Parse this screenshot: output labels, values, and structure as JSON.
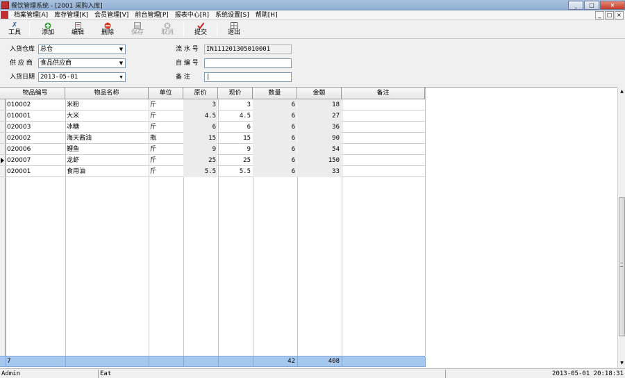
{
  "window": {
    "title": "餐饮管理系统 - [2001 采购入库]",
    "btn_min": "_",
    "btn_max": "□",
    "btn_close": "×"
  },
  "menu": {
    "items": [
      "档案管理[A]",
      "库存管理[K]",
      "会员管理[V]",
      "前台管理[P]",
      "报表中心[R]",
      "系统设置[S]",
      "帮助[H]"
    ],
    "mdi_min": "_",
    "mdi_restore": "□",
    "mdi_close": "×"
  },
  "toolbar": {
    "tools": "工具",
    "add": "添加",
    "edit": "编辑",
    "delete": "删除",
    "save": "保存",
    "cancel": "取消",
    "submit": "提交",
    "exit": "退出"
  },
  "form": {
    "warehouse_label": "入货仓库",
    "warehouse_value": "总仓",
    "supplier_label": "供 应 商",
    "supplier_value": "食品供应商",
    "date_label": "入货日期",
    "date_value": "2013-05-01",
    "serial_label": "流 水 号",
    "serial_value": "IN111201305010001",
    "code_label": "自 编 号",
    "code_value": "",
    "remark_label": "备    注",
    "remark_value": "|"
  },
  "table": {
    "columns": [
      "物品编号",
      "物品名称",
      "单位",
      "原价",
      "现价",
      "数量",
      "金额",
      "备注"
    ],
    "rows": [
      [
        "010002",
        "米粉",
        "斤",
        "3",
        "3",
        "6",
        "18",
        ""
      ],
      [
        "010001",
        "大米",
        "斤",
        "4.5",
        "4.5",
        "6",
        "27",
        ""
      ],
      [
        "020003",
        "冰糖",
        "斤",
        "6",
        "6",
        "6",
        "36",
        ""
      ],
      [
        "020002",
        "海天酱油",
        "瓶",
        "15",
        "15",
        "6",
        "90",
        ""
      ],
      [
        "020006",
        "鲤鱼",
        "斤",
        "9",
        "9",
        "6",
        "54",
        ""
      ],
      [
        "020007",
        "龙虾",
        "斤",
        "25",
        "25",
        "6",
        "150",
        ""
      ],
      [
        "020001",
        "食用油",
        "斤",
        "5.5",
        "5.5",
        "6",
        "33",
        ""
      ]
    ],
    "current_row": 5,
    "footer": {
      "count": "7",
      "qty_total": "42",
      "amount_total": "408"
    }
  },
  "status": {
    "user": "Admin",
    "module": "Eat",
    "datetime": "2013-05-01  20:18:31"
  },
  "icons": [
    "tools-icon",
    "add-icon",
    "edit-icon",
    "delete-icon",
    "save-icon",
    "cancel-icon",
    "submit-icon",
    "exit-icon"
  ]
}
